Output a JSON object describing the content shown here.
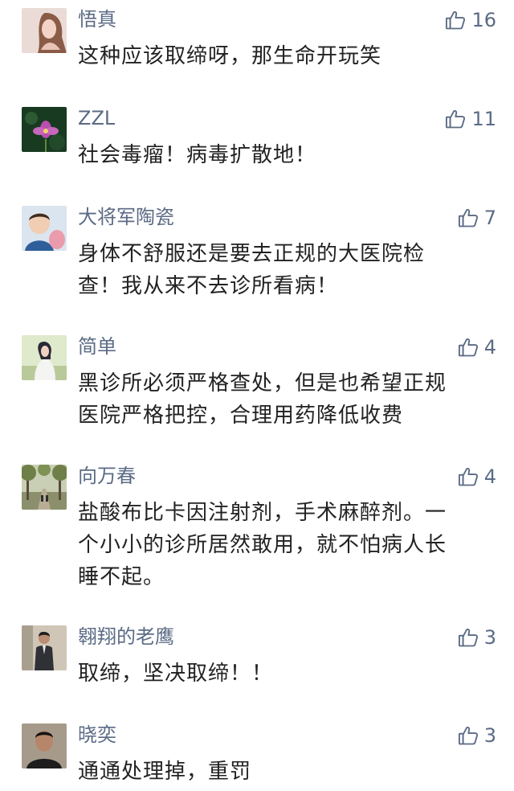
{
  "comments": [
    {
      "name": "悟真",
      "text": "这种应该取缔呀，那生命开玩笑",
      "likes": "16",
      "avatar_icon": "woman-portrait-avatar",
      "avatar_colors": [
        "#e8d4cc",
        "#b07a62"
      ]
    },
    {
      "name": "ZZL",
      "text": "社会毒瘤！病毒扩散地！",
      "likes": "11",
      "avatar_icon": "flower-avatar",
      "avatar_colors": [
        "#16321c",
        "#b34aa8"
      ]
    },
    {
      "name": "大将军陶瓷",
      "text": "身体不舒服还是要去正规的大医院检查！我从来不去诊所看病！",
      "likes": "7",
      "avatar_icon": "baby-avatar",
      "avatar_colors": [
        "#d6e2ef",
        "#e69aa8"
      ]
    },
    {
      "name": "简单",
      "text": "黑诊所必须严格查处，但是也希望正规医院严格把控，合理用药降低收费",
      "likes": "4",
      "avatar_icon": "woman-white-dress-avatar",
      "avatar_colors": [
        "#d8e6c2",
        "#2d2d3a"
      ]
    },
    {
      "name": "向万春",
      "text": "盐酸布比卡因注射剂，手术麻醉剂。一个小小的诊所居然敢用，就不怕病人长睡不起。",
      "likes": "4",
      "avatar_icon": "trees-path-avatar",
      "avatar_colors": [
        "#a7b38a",
        "#5e6d44"
      ]
    },
    {
      "name": "翱翔的老鹰",
      "text": "取缔，坚决取缔！！",
      "likes": "3",
      "avatar_icon": "man-suit-avatar",
      "avatar_colors": [
        "#c8bfb0",
        "#34363b"
      ]
    },
    {
      "name": "晓奕",
      "text": "通通处理掉，重罚",
      "likes": "3",
      "avatar_icon": "man-portrait-avatar",
      "avatar_colors": [
        "#9a8f80",
        "#1f1f1f"
      ]
    }
  ],
  "like_icon": "thumbs-up-icon",
  "colors": {
    "name": "#5b6b85",
    "text": "#222222",
    "like": "#5b6b85"
  }
}
